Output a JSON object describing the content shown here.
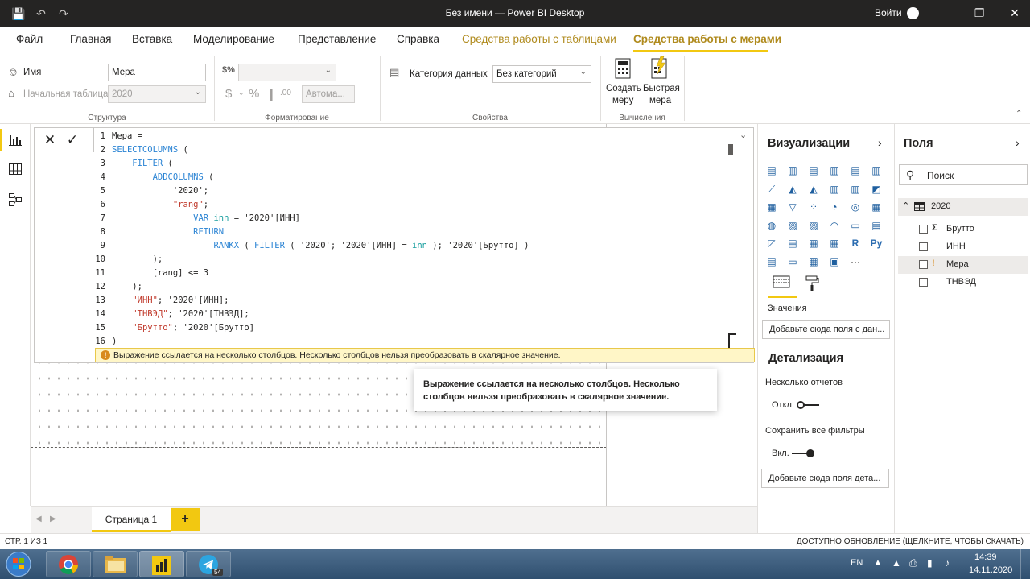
{
  "titlebar": {
    "title": "Без имени — Power BI Desktop",
    "sign_in": "Войти"
  },
  "menu": [
    "Файл",
    "Главная",
    "Вставка",
    "Моделирование",
    "Представление",
    "Справка",
    "Средства работы с таблицами",
    "Средства работы с мерами"
  ],
  "ribbon": {
    "name_label": "Имя",
    "name_value": "Мера",
    "home_table_label": "Начальная таблица",
    "home_table_value": "2020",
    "group_structure": "Структура",
    "format_value": "",
    "auto_label": "Автома...",
    "group_formatting": "Форматирование",
    "data_category_label": "Категория данных",
    "data_category_value": "Без категорий",
    "group_properties": "Свойства",
    "new_measure_line1": "Создать",
    "new_measure_line2": "меру",
    "quick_measure_line1": "Быстрая",
    "quick_measure_line2": "мера",
    "group_calculations": "Вычисления"
  },
  "code_lines": [
    {
      "n": "1",
      "t": "Мера ="
    },
    {
      "n": "2",
      "t": "SELECTCOLUMNS ("
    },
    {
      "n": "3",
      "t": "    FILTER ("
    },
    {
      "n": "4",
      "t": "        ADDCOLUMNS ("
    },
    {
      "n": "5",
      "t": "            '2020';"
    },
    {
      "n": "6",
      "t": "            \"rang\";"
    },
    {
      "n": "7",
      "t": "                VAR inn = '2020'[ИНН]"
    },
    {
      "n": "8",
      "t": "                RETURN"
    },
    {
      "n": "9",
      "t": "                    RANKX ( FILTER ( '2020'; '2020'[ИНН] = inn ); '2020'[Брутто] )"
    },
    {
      "n": "10",
      "t": "        );"
    },
    {
      "n": "11",
      "t": "        [rang] <= 3"
    },
    {
      "n": "12",
      "t": "    );"
    },
    {
      "n": "13",
      "t": "    \"ИНН\"; '2020'[ИНН];"
    },
    {
      "n": "14",
      "t": "    \"ТНВЭД\"; '2020'[ТНВЭД];"
    },
    {
      "n": "15",
      "t": "    \"Брутто\"; '2020'[Брутто]"
    },
    {
      "n": "16",
      "t": ")"
    }
  ],
  "error_message": "Выражение ссылается на несколько столбцов. Несколько столбцов нельзя преобразовать в скалярное значение.",
  "tooltip_text": "Выражение ссылается на несколько столбцов. Несколько столбцов нельзя преобразовать в скалярное значение.",
  "pages": {
    "page1": "Страница 1",
    "add": "+"
  },
  "viz": {
    "title": "Визуализации",
    "values_label": "Значения",
    "values_placeholder": "Добавьте сюда поля с дан...",
    "drill_title": "Детализация",
    "cross_report_label": "Несколько отчетов",
    "cross_report_state": "Откл.",
    "keep_filters_label": "Сохранить все фильтры",
    "keep_filters_state": "Вкл.",
    "drill_placeholder": "Добавьте сюда поля дета...",
    "more": "···"
  },
  "fields": {
    "title": "Поля",
    "search_placeholder": "Поиск",
    "table_name": "2020",
    "items": [
      {
        "name": "Брутто",
        "icon": "Σ"
      },
      {
        "name": "ИНН",
        "icon": ""
      },
      {
        "name": "Мера",
        "icon": "!"
      },
      {
        "name": "ТНВЭД",
        "icon": ""
      }
    ]
  },
  "status": {
    "page_info": "СТР. 1 ИЗ 1",
    "update": "ДОСТУПНО ОБНОВЛЕНИЕ (ЩЕЛКНИТЕ, ЧТОБЫ СКАЧАТЬ)"
  },
  "taskbar": {
    "lang": "EN",
    "time": "14:39",
    "date": "14.11.2020",
    "telegram_badge": "54"
  },
  "colors": {
    "accent": "#f2c811",
    "titlebar": "#252423",
    "keyword": "#2b84d4",
    "string": "#c0392b",
    "error_bg": "#fff6c7"
  }
}
